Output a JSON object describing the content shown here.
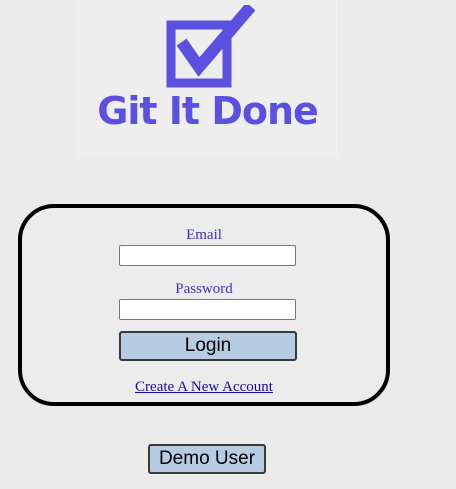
{
  "logo": {
    "text": "Git It Done",
    "icon": "checkbox-check-icon",
    "color": "#5b50e0"
  },
  "login_form": {
    "email_label": "Email",
    "email_value": "",
    "password_label": "Password",
    "password_value": "",
    "login_label": "Login",
    "create_account_label": "Create A New Account"
  },
  "demo": {
    "label": "Demo User"
  },
  "colors": {
    "background": "#ebebeb",
    "button": "#b6cce3",
    "label": "#3b33b8",
    "link": "#1a0dab"
  }
}
